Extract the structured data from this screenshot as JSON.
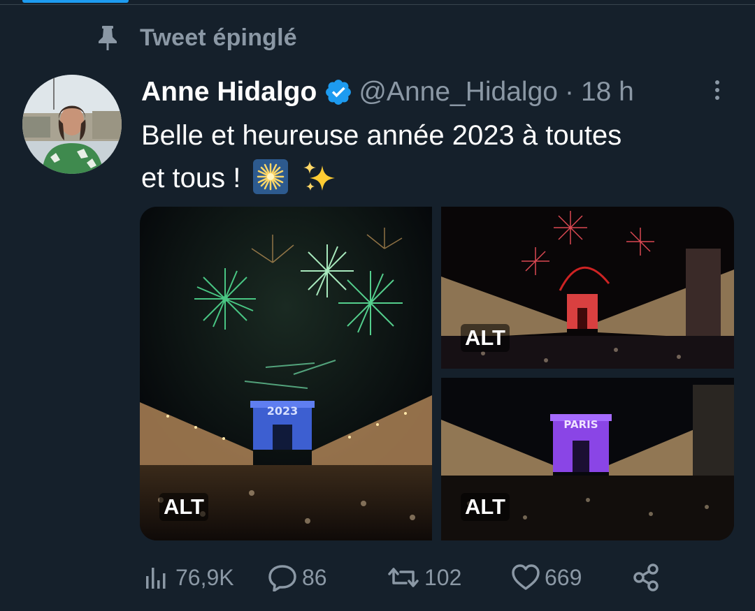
{
  "pinned": {
    "label": "Tweet épinglé",
    "icon": "pin-icon"
  },
  "tweet": {
    "author_name": "Anne Hidalgo",
    "verified": true,
    "handle": "@Anne_Hidalgo",
    "separator": "·",
    "time": "18 h",
    "text_line1": "Belle et heureuse année 2023 à toutes",
    "text_line2": "et tous !",
    "emojis": [
      "sparkler-icon",
      "sparkles-icon"
    ]
  },
  "media": {
    "alt_badge": "ALT",
    "photos": [
      {
        "scene": "green fireworks over Arc de Triomphe",
        "overlay_text": "2023"
      },
      {
        "scene": "red fireworks over Champs-Élysées"
      },
      {
        "scene": "Arc de Triomphe lit purple",
        "overlay_text": "PARIS"
      }
    ]
  },
  "actions": {
    "views": "76,9K",
    "replies": "86",
    "retweets": "102",
    "likes": "669"
  },
  "colors": {
    "background": "#15202b",
    "secondary_text": "#8b98a5",
    "accent": "#1d9bf0"
  }
}
